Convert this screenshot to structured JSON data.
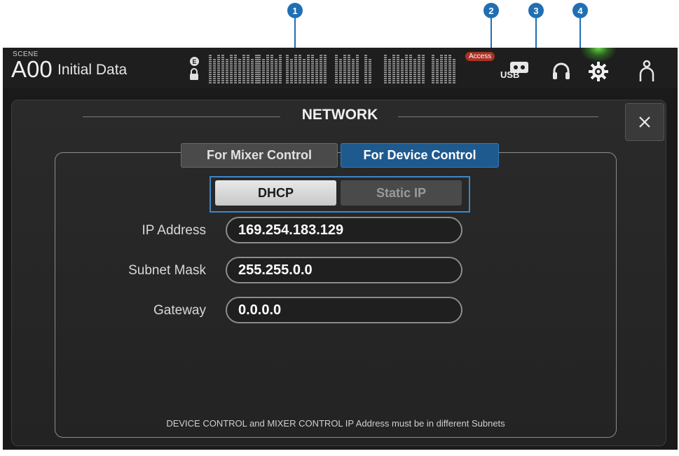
{
  "callouts": [
    "1",
    "2",
    "3",
    "4"
  ],
  "header": {
    "scene_label": "SCENE",
    "scene_number": "A00",
    "scene_title": "Initial Data",
    "e_badge": "E",
    "access_badge": "Access",
    "usb_label": "USB"
  },
  "panel": {
    "title": "NETWORK",
    "tabs": [
      {
        "label": "For Mixer Control",
        "active": false
      },
      {
        "label": "For Device Control",
        "active": true
      }
    ],
    "mode": {
      "options": [
        "DHCP",
        "Static IP"
      ],
      "selected": "DHCP"
    },
    "fields": [
      {
        "label": "IP Address",
        "value": "169.254.183.129"
      },
      {
        "label": "Subnet Mask",
        "value": "255.255.0.0"
      },
      {
        "label": "Gateway",
        "value": "0.0.0.0"
      }
    ],
    "footnote": "DEVICE CONTROL and MIXER CONTROL IP Address must be in different Subnets"
  },
  "colors": {
    "accent": "#1f6fb3",
    "active_tab": "#1f5a8e",
    "access_badge": "#a93226"
  }
}
